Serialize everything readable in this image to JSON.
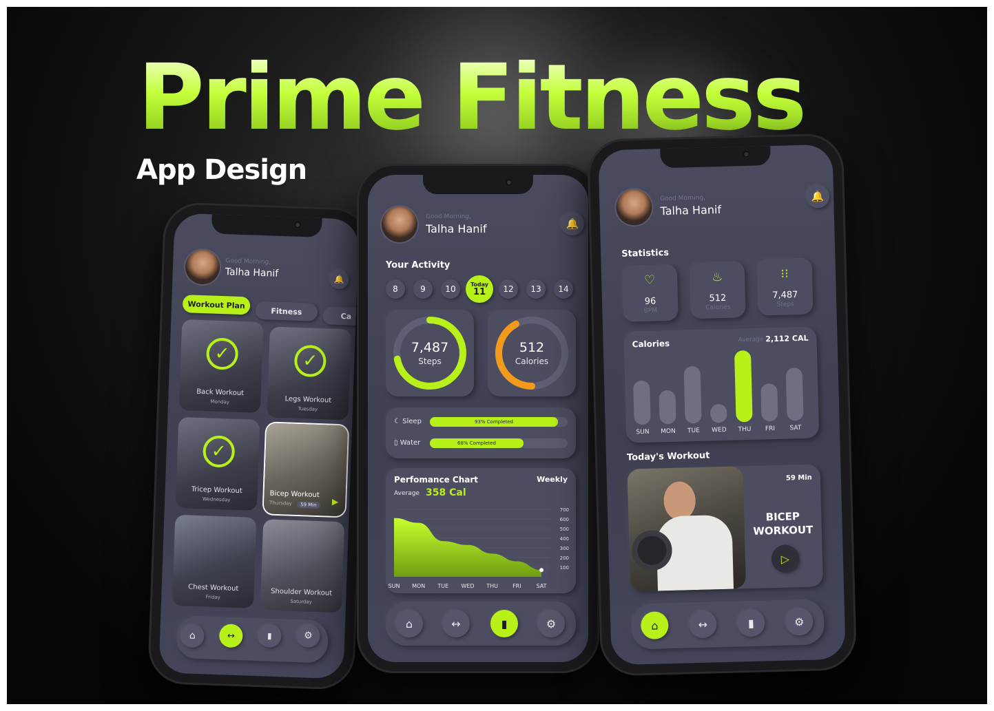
{
  "hero": {
    "title": "Prime Fitness",
    "subtitle": "App Design"
  },
  "user": {
    "greeting": "Good Morning,",
    "name": "Talha Hanif"
  },
  "phone1": {
    "tabs": [
      "Workout Plan",
      "Fitness",
      "Ca"
    ],
    "workouts": [
      {
        "name": "Back Workout",
        "day": "Monday",
        "done": true
      },
      {
        "name": "Legs Workout",
        "day": "Tuesday",
        "done": true
      },
      {
        "name": "Tricep Workout",
        "day": "Wednesday",
        "done": true
      },
      {
        "name": "Bicep Workout",
        "day": "Thursday",
        "duration": "59 Min",
        "done": false
      },
      {
        "name": "Chest Workout",
        "day": "Friday",
        "done": false
      },
      {
        "name": "Shoulder Workout",
        "day": "Saturday",
        "done": false
      }
    ]
  },
  "phone2": {
    "activity_title": "Your Activity",
    "days": [
      "8",
      "9",
      "10",
      "11",
      "12",
      "13",
      "14"
    ],
    "today_label": "Today",
    "steps": {
      "value": "7,487",
      "label": "Steps",
      "progress": 0.72
    },
    "calories": {
      "value": "512",
      "label": "Calories",
      "progress": 0.42
    },
    "sleep": {
      "label": "Sleep",
      "text": "93% Completed",
      "pct": 0.93
    },
    "water": {
      "label": "Water",
      "text": "68% Completed",
      "pct": 0.68
    },
    "perf": {
      "title": "Perfomance Chart",
      "period": "Weekly",
      "avg_label": "Average",
      "avg_value": "358 Cal"
    }
  },
  "chart_data": {
    "type": "area",
    "title": "Perfomance Chart",
    "categories": [
      "SUN",
      "MON",
      "TUE",
      "WED",
      "THU",
      "FRI",
      "SAT"
    ],
    "values": [
      610,
      560,
      370,
      330,
      240,
      160,
      70
    ],
    "yticks": [
      "700",
      "600",
      "500",
      "400",
      "300",
      "200",
      "100"
    ],
    "ylim": [
      0,
      700
    ],
    "grid": true
  },
  "phone3": {
    "stats_title": "Statistics",
    "stats": [
      {
        "icon": "heart-rate-icon",
        "value": "96",
        "label": "BPM"
      },
      {
        "icon": "flame-icon",
        "value": "512",
        "label": "Calories"
      },
      {
        "icon": "footsteps-icon",
        "value": "7,487",
        "label": "Steps"
      }
    ],
    "calories_title": "Calories",
    "avg_label": "Average",
    "avg_value": "2,112 CAL",
    "cal_days": [
      "SUN",
      "MON",
      "TUE",
      "WED",
      "THU",
      "FRI",
      "SAT"
    ],
    "cal_values": [
      0.62,
      0.47,
      0.8,
      0.26,
      1.0,
      0.53,
      0.74
    ],
    "today_title": "Today's Workout",
    "workout_name": "BICEP WORKOUT",
    "workout_duration": "59 Min"
  },
  "colors": {
    "accent": "#b8f11a",
    "calories_ring": "#f29a1c",
    "surface": "#4c4d60"
  }
}
